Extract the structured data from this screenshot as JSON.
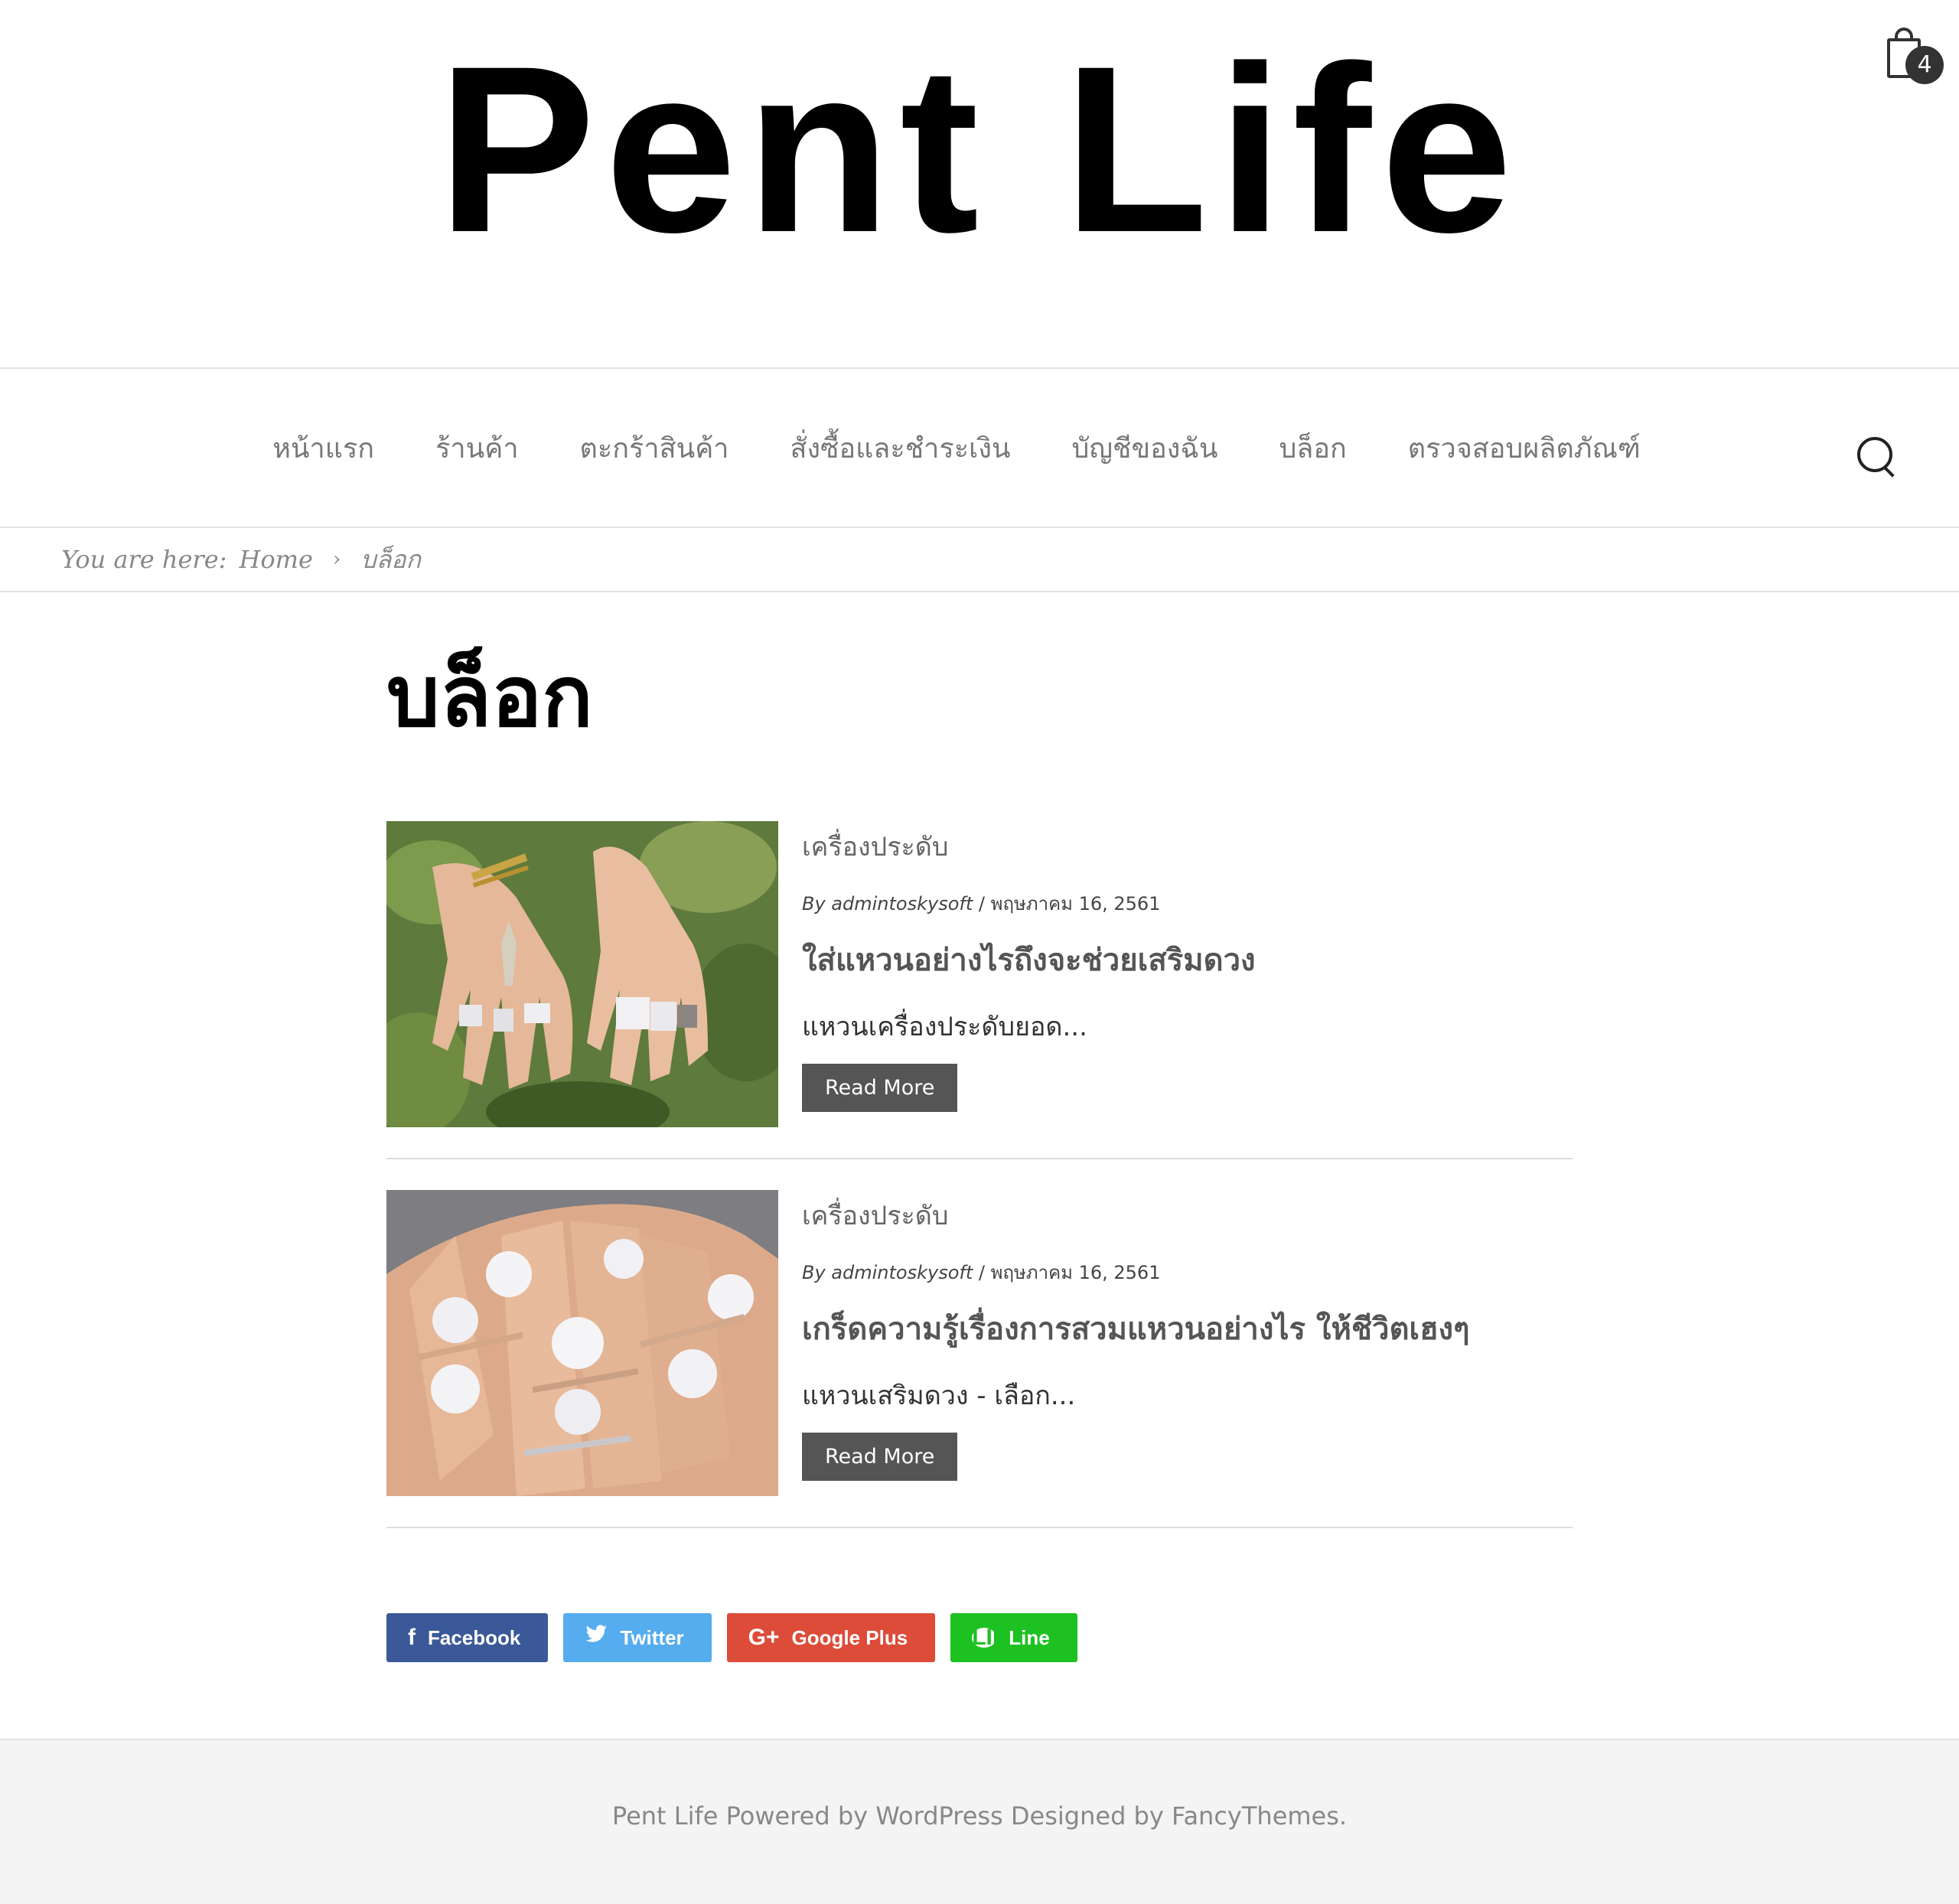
{
  "site": {
    "title": "Pent Life"
  },
  "cart": {
    "count": "4",
    "icon": "shopping-bag-icon"
  },
  "nav": {
    "items": [
      {
        "label": "หน้าแรก"
      },
      {
        "label": "ร้านค้า"
      },
      {
        "label": "ตะกร้าสินค้า"
      },
      {
        "label": "สั่งซื้อและชำระเงิน"
      },
      {
        "label": "บัญชีของฉัน"
      },
      {
        "label": "บล็อก"
      },
      {
        "label": "ตรวจสอบผลิตภัณฑ์"
      }
    ],
    "search_icon": "search-icon"
  },
  "breadcrumb": {
    "prefix": "You are here:",
    "home": "Home",
    "separator": "›",
    "current": "บล็อก"
  },
  "page": {
    "title": "บล็อก"
  },
  "posts": [
    {
      "category": "เครื่องประดับ",
      "author": "By admintoskysoft",
      "date_sep": "/",
      "date": "พฤษภาคม 16, 2561",
      "title": "ใส่แหวนอย่างไรถึงจะช่วยเสริมดวง",
      "excerpt": "แหวนเครื่องประดับยอด...",
      "read_more": "Read More"
    },
    {
      "category": "เครื่องประดับ",
      "author": "By admintoskysoft",
      "date_sep": "/",
      "date": "พฤษภาคม 16, 2561",
      "title": "เกร็ดความรู้เรื่องการสวมแหวนอย่างไร ให้ชีวิตเฮงๆ",
      "excerpt": "แหวนเสริมดวง - เลือก...",
      "read_more": "Read More"
    }
  ],
  "share": {
    "facebook": "Facebook",
    "twitter": "Twitter",
    "google_plus": "Google Plus",
    "line": "Line",
    "line_icon_text": "LINE",
    "colors": {
      "facebook": "#3b5998",
      "twitter": "#55acee",
      "google_plus": "#dd4b39",
      "line": "#1ec122"
    }
  },
  "footer": {
    "text": "Pent Life Powered by WordPress Designed by FancyThemes."
  }
}
